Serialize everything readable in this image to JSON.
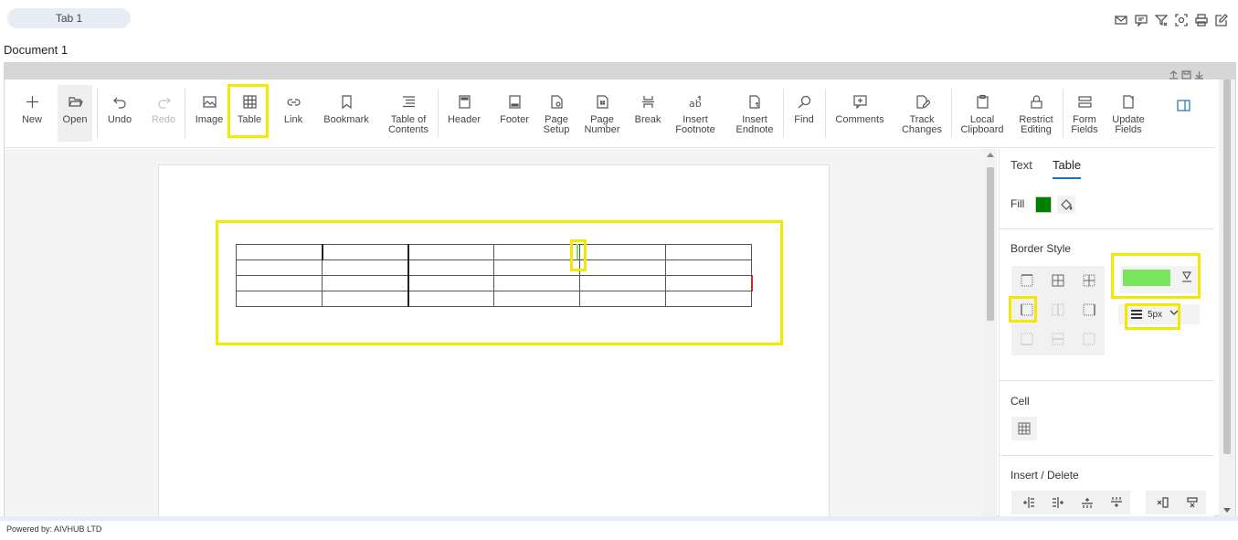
{
  "tabs": [
    {
      "label": "Tab 1"
    }
  ],
  "top_icons": [
    "mail-icon",
    "comment-icon",
    "filter-icon",
    "screenshot-icon",
    "print-icon",
    "edit-icon"
  ],
  "document": {
    "title": "Document 1"
  },
  "toolbar": {
    "new": "New",
    "open": "Open",
    "undo": "Undo",
    "redo": "Redo",
    "image": "Image",
    "table": "Table",
    "link": "Link",
    "bookmark": "Bookmark",
    "toc_line1": "Table of",
    "toc_line2": "Contents",
    "header": "Header",
    "footer": "Footer",
    "page_setup_line1": "Page",
    "page_setup_line2": "Setup",
    "page_number_line1": "Page",
    "page_number_line2": "Number",
    "break": "Break",
    "insert_footnote_line1": "Insert",
    "insert_footnote_line2": "Footnote",
    "insert_endnote_line1": "Insert",
    "insert_endnote_line2": "Endnote",
    "find": "Find",
    "comments": "Comments",
    "track_changes_line1": "Track",
    "track_changes_line2": "Changes",
    "local_clipboard_line1": "Local",
    "local_clipboard_line2": "Clipboard",
    "restrict_editing_line1": "Restrict",
    "restrict_editing_line2": "Editing",
    "form_fields_line1": "Form",
    "form_fields_line2": "Fields",
    "update_fields_line1": "Update",
    "update_fields_line2": "Fields"
  },
  "pane": {
    "tabs": {
      "text": "Text",
      "table": "Table"
    },
    "fill_label": "Fill",
    "fill_color": "#008000",
    "border_style_title": "Border Style",
    "border_color": "#7ae55a",
    "border_width": "5px",
    "cell_title": "Cell",
    "insert_delete_title": "Insert / Delete"
  },
  "table": {
    "rows": 4,
    "cols": 6
  },
  "footer": {
    "text": "Powered by: AIVHUB LTD"
  }
}
